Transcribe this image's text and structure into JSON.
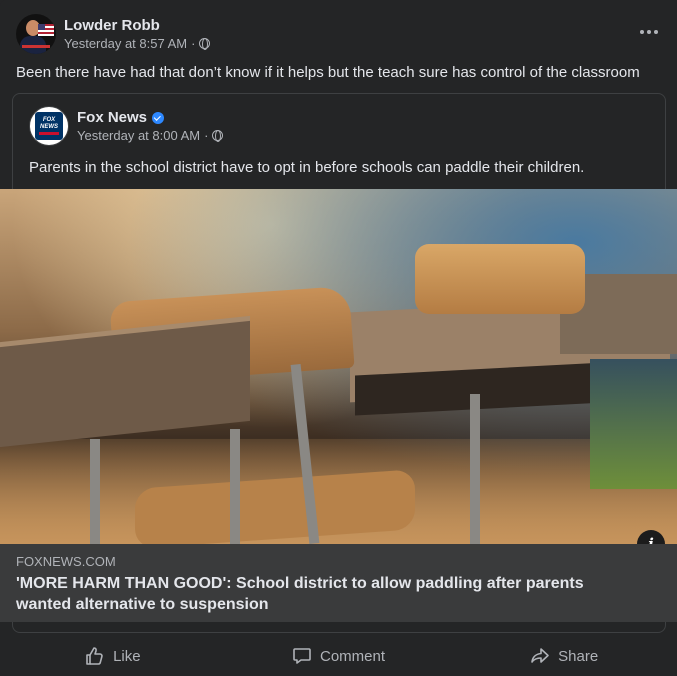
{
  "post": {
    "author": "Lowder Robb",
    "timestamp": "Yesterday at 8:57 AM",
    "separator": "·",
    "privacy_icon": "globe-icon",
    "caption": "Been there have had that don’t know if it helps but the teach sure has control of the classroom"
  },
  "shared": {
    "page_name": "Fox News",
    "verified": true,
    "timestamp": "Yesterday at 8:00 AM",
    "separator": "·",
    "privacy_icon": "globe-icon",
    "text": "Parents in the school district have to opt in before schools can paddle their children.",
    "logo_text": "FOX NEWS"
  },
  "link": {
    "domain": "FOXNEWS.COM",
    "headline": "'MORE HARM THAN GOOD': School district to allow paddling after parents wanted alternative to suspension",
    "info_label": "i"
  },
  "actions": {
    "like": "Like",
    "comment": "Comment",
    "share": "Share"
  },
  "colors": {
    "background": "#242526",
    "text": "#e4e6eb",
    "secondary_text": "#b0b3b8",
    "verified": "#2d88ff",
    "link_box": "#3a3b3c"
  }
}
